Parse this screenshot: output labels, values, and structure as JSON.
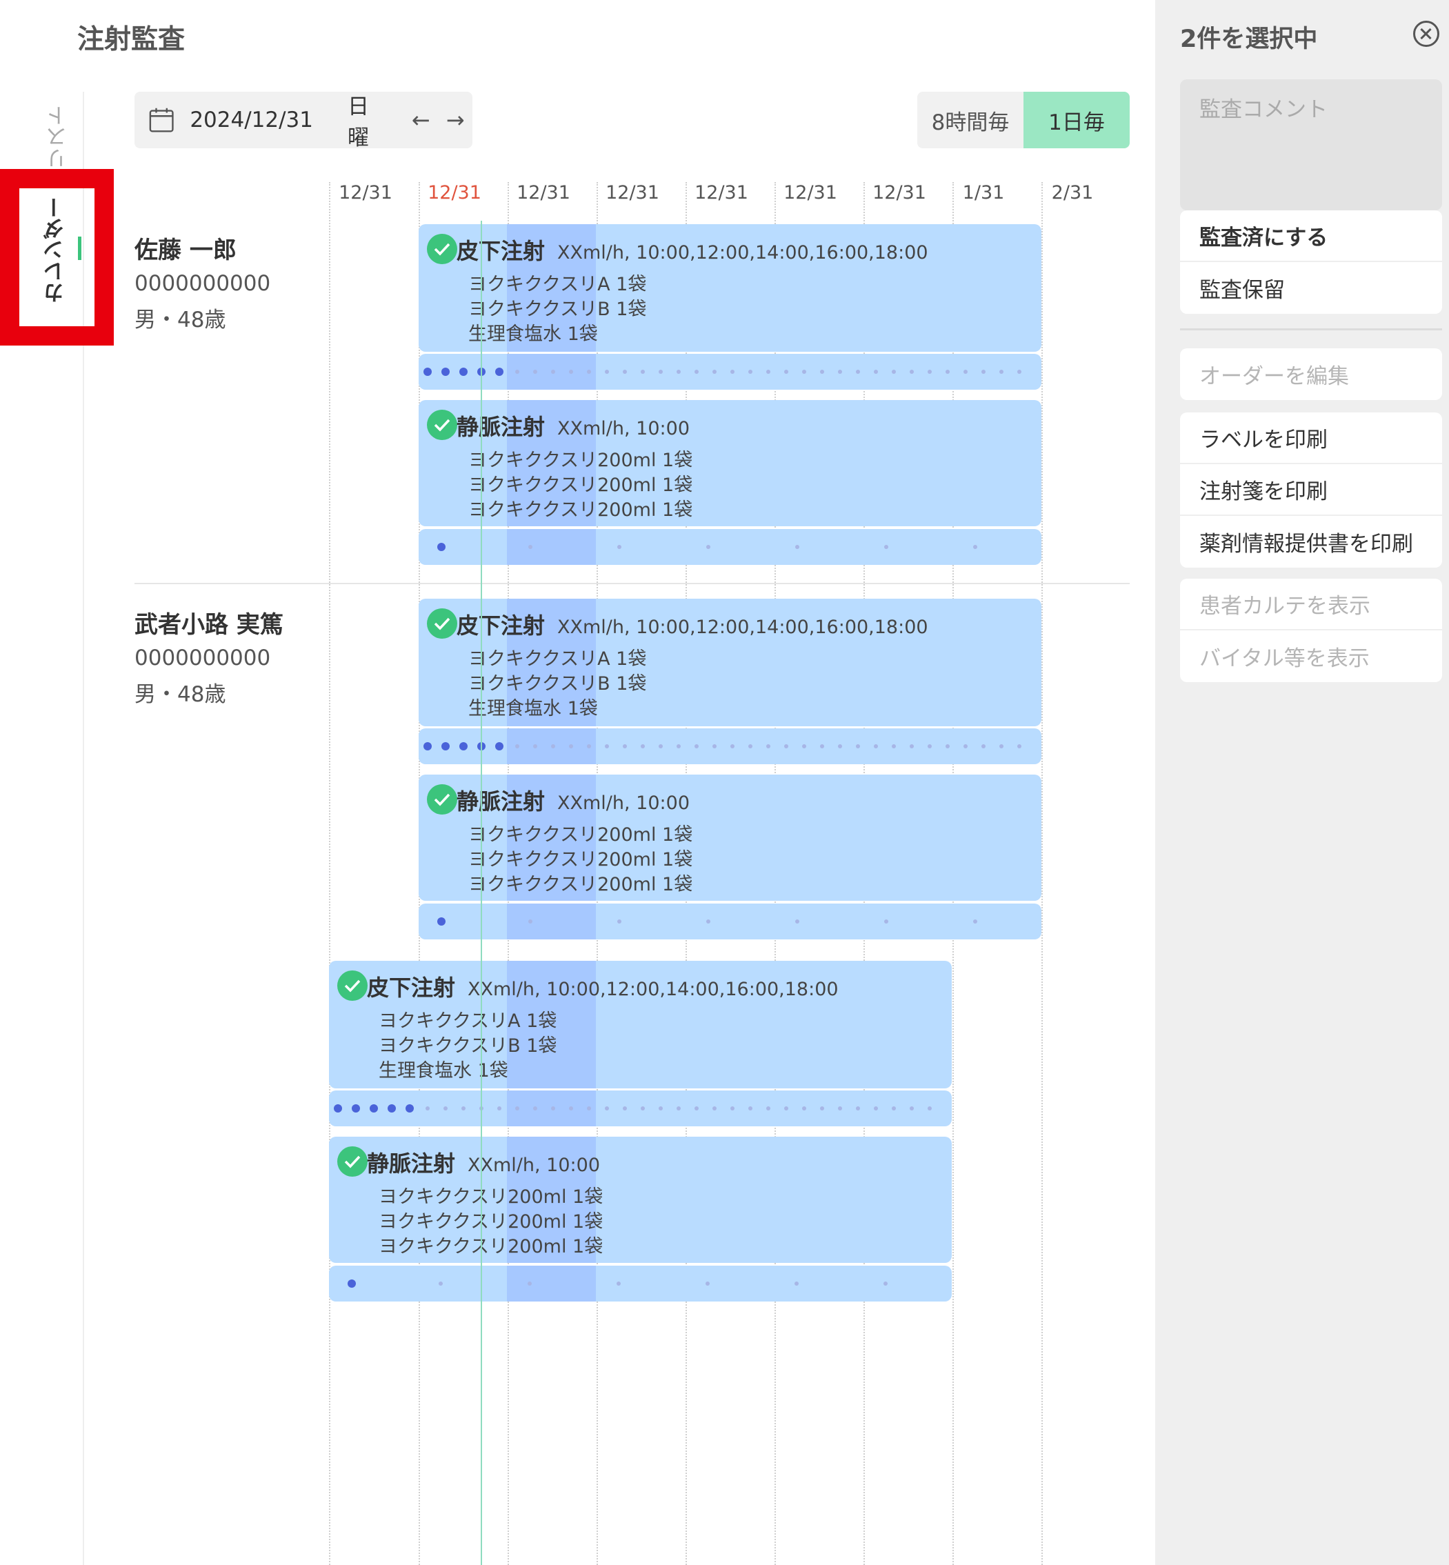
{
  "page": {
    "title": "注射監査"
  },
  "sidebar_tabs": {
    "list": "リスト",
    "calendar": "カレンダー"
  },
  "toolbar": {
    "date": "2024/12/31",
    "day_of_week": "日曜",
    "prev": "←",
    "next": "→",
    "interval_8h": "8時間毎",
    "interval_1d": "1日毎",
    "selected_interval": "1日毎"
  },
  "timeline": {
    "columns": [
      "12/31",
      "12/31",
      "12/31",
      "12/31",
      "12/31",
      "12/31",
      "12/31",
      "1/31",
      "2/31"
    ],
    "today_index": 1
  },
  "patients": [
    {
      "name": "佐藤 一郎",
      "id": "0000000000",
      "info": "男・48歳"
    },
    {
      "name": "武者小路 実篤",
      "id": "0000000000",
      "info": "男・48歳"
    }
  ],
  "orders": {
    "subq": {
      "title": "皮下注射",
      "schedule": "XXml/h, 10:00,12:00,14:00,16:00,18:00",
      "items": [
        "ヨクキククスリA 1袋",
        "ヨクキククスリB 1袋",
        "生理食塩水 1袋"
      ]
    },
    "iv": {
      "title": "静脈注射",
      "schedule": "XXml/h, 10:00",
      "items": [
        "ヨクキククスリ200ml 1袋",
        "ヨクキククスリ200ml 1袋",
        "ヨクキククスリ200ml 1袋"
      ]
    }
  },
  "right_panel": {
    "title": "2件を選択中",
    "comment_placeholder": "監査コメント",
    "audit_actions": [
      "監査済にする",
      "監査保留"
    ],
    "edit_order": "オーダーを編集",
    "print_actions": [
      "ラベルを印刷",
      "注射箋を印刷",
      "薬剤情報提供書を印刷"
    ],
    "view_actions": [
      "患者カルテを表示",
      "バイタル等を表示"
    ]
  },
  "colors": {
    "accent": "#3cc47c",
    "toggle_active": "#9be7c3",
    "card": "#b9dcff",
    "card_focus": "#a6c8ff",
    "today": "#e0533d",
    "highlight": "#e8000d"
  }
}
